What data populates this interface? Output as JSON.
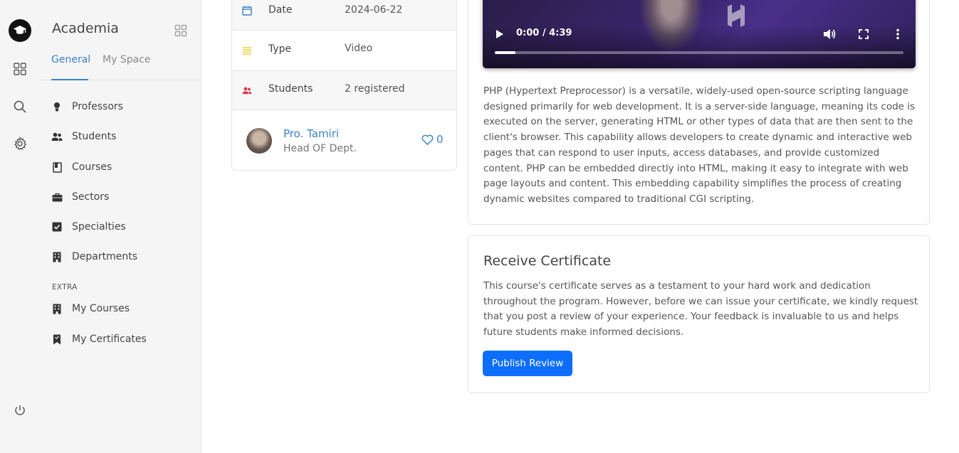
{
  "app": {
    "brand": "Academia"
  },
  "tabs": [
    {
      "label": "General",
      "active": true
    },
    {
      "label": "My Space",
      "active": false
    }
  ],
  "menu": [
    {
      "label": "Professors",
      "icon": "professor-icon"
    },
    {
      "label": "Students",
      "icon": "users-icon"
    },
    {
      "label": "Courses",
      "icon": "book-icon"
    },
    {
      "label": "Sectors",
      "icon": "briefcase-icon"
    },
    {
      "label": "Specialties",
      "icon": "checkbox-icon"
    },
    {
      "label": "Departments",
      "icon": "building-icon"
    }
  ],
  "extra_section": {
    "label": "EXTRA",
    "items": [
      {
        "label": "My Courses",
        "icon": "building-icon"
      },
      {
        "label": "My Certificates",
        "icon": "bookmark-icon"
      }
    ]
  },
  "course_info": {
    "rows": [
      {
        "key": "Date",
        "value": "2024-06-22",
        "icon": "calendar-icon",
        "color": "#3b82c4"
      },
      {
        "key": "Type",
        "value": "Video",
        "icon": "list-icon",
        "color": "#e6c619"
      },
      {
        "key": "Students",
        "value": "2 registered",
        "icon": "users-icon",
        "color": "#dc3545"
      }
    ],
    "professor": {
      "name": "Pro. Tamiri",
      "role": "Head OF Dept.",
      "likes": "0"
    }
  },
  "video": {
    "time": "0:00 / 4:39",
    "progress": 0.05
  },
  "description": "PHP (Hypertext Preprocessor) is a versatile, widely-used open-source scripting language designed primarily for web development. It is a server-side language, meaning its code is executed on the server, generating HTML or other types of data that are then sent to the client's browser. This capability allows developers to create dynamic and interactive web pages that can respond to user inputs, access databases, and provide customized content. PHP can be embedded directly into HTML, making it easy to integrate with web page layouts and content. This embedding capability simplifies the process of creating dynamic websites compared to traditional CGI scripting.",
  "certificate": {
    "title": "Receive Certificate",
    "text": "This course's certificate serves as a testament to your hard work and dedication throughout the program. However, before we can issue your certificate, we kindly request that you post a review of your experience. Your feedback is invaluable to us and helps future students make informed decisions.",
    "button": "Publish Review"
  },
  "colors": {
    "accent": "#3b82c4",
    "primary_button": "#0d6efd"
  }
}
